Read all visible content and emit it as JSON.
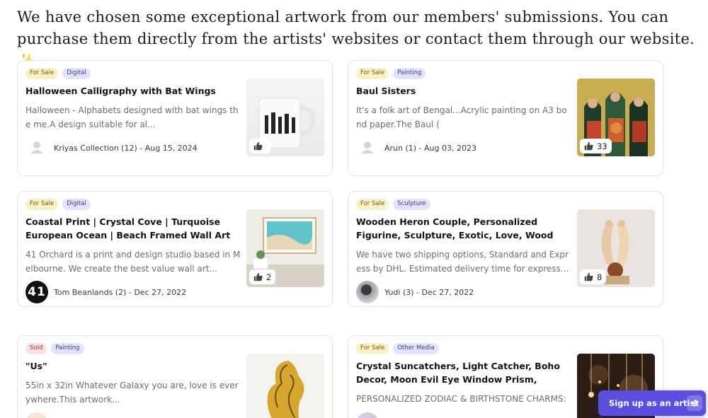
{
  "intro": "We have chosen some exceptional artwork from our members' submissions. You can purchase them directly from the artists' websites or contact them through our website. ✨",
  "cards": [
    {
      "status": "For Sale",
      "category": "Digital",
      "title": "Halloween Calligraphy with Bat Wings",
      "desc": "Halloween - Alphabets designed with bat wings the me.A design suitable for al...",
      "author": "Kriyas Collection (12) - Aug 15, 2024",
      "likes": "",
      "avatar": "placeholder-avatar"
    },
    {
      "status": "For Sale",
      "category": "Painting",
      "title": "Baul Sisters",
      "desc": "It's a folk art of Bengal...Acrylic painting on A3 bond paper.The Baul (",
      "author": "Arun (1) - Aug 03, 2023",
      "likes": "33",
      "avatar": "placeholder-avatar"
    },
    {
      "status": "For Sale",
      "category": "Digital",
      "title": "Coastal Print | Crystal Cove | Turquoise European Ocean | Beach Framed Wall Art or Poster...",
      "desc": "41 Orchard is a print and design studio based in Melbourne. We create the best value wall art...",
      "author": "Tom Beanlands (2) - Dec 27, 2022",
      "likes": "2",
      "avatar_text": "41"
    },
    {
      "status": "For Sale",
      "category": "Sculpture",
      "title": "Wooden Heron Couple, Personalized Figurine, Sculpture, Exotic, Love, Wood Carving, Bird Statu...",
      "desc": "We have two shipping options, Standard and Express by DHL. Estimated delivery time for express...",
      "author": "Yudi (3) - Dec 27, 2022",
      "likes": "8",
      "avatar": "photo-avatar"
    },
    {
      "status": "Sold",
      "category": "Painting",
      "title": "\"Us\"",
      "desc": "55in x 32in Whatever Galaxy you are, love is everywhere.This artwork...",
      "author": "",
      "likes": "",
      "avatar": "logo-avatar"
    },
    {
      "status": "For Sale",
      "category": "Other Media",
      "title": "Crystal Suncatchers, Light Catcher, Boho Decor, Moon Evil Eye Window Prism, Witchy Decor,...",
      "desc": "PERSONALIZED ZODIAC & BIRTHSTONE CHARMS:",
      "author": "",
      "likes": "",
      "avatar": "lilac-avatar"
    }
  ],
  "signup": {
    "label": "Sign up as an artist",
    "icon": "arrow-right-icon"
  },
  "colors": {
    "accent": "#5b4fe0",
    "for_sale_tag": "#fbf1c6",
    "sold_tag": "#fde1de",
    "category_tag": "#e4e3fb"
  }
}
